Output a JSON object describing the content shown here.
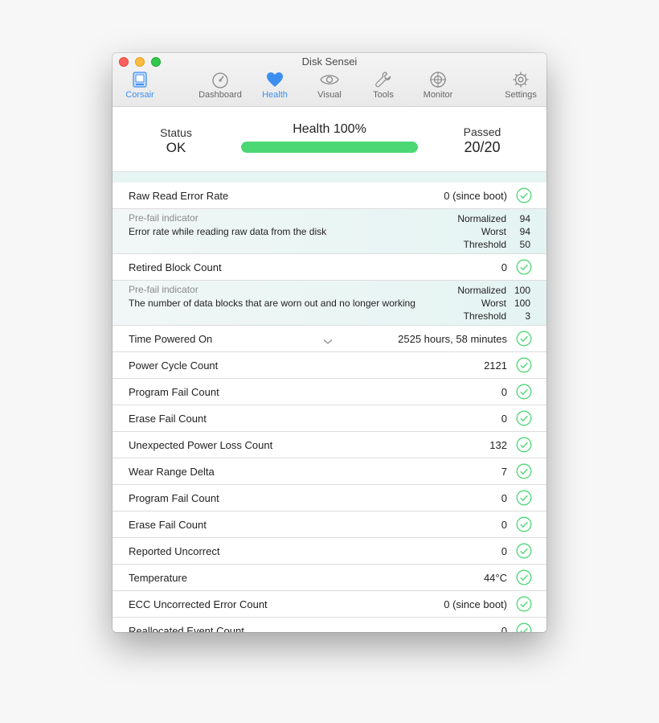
{
  "window": {
    "title": "Disk Sensei"
  },
  "toolbar": {
    "items": [
      {
        "label": "Corsair",
        "icon": "disk-icon",
        "active": true
      },
      {
        "label": "Dashboard",
        "icon": "gauge-icon"
      },
      {
        "label": "Health",
        "icon": "heart-icon",
        "active": true
      },
      {
        "label": "Visual",
        "icon": "eye-icon"
      },
      {
        "label": "Tools",
        "icon": "wrench-icon"
      },
      {
        "label": "Monitor",
        "icon": "crosshair-icon"
      },
      {
        "label": "Settings",
        "icon": "gear-icon"
      }
    ]
  },
  "summary": {
    "status_label": "Status",
    "status_value": "OK",
    "health_label": "Health 100%",
    "health_percent": 100,
    "passed_label": "Passed",
    "passed_value": "20/20"
  },
  "colors": {
    "accent": "#3c8ff0",
    "health_bar": "#4cd775",
    "check": "#4cd775",
    "detail_bg": "#e4f4f2"
  },
  "attributes": [
    {
      "name": "Raw Read Error Rate",
      "value": "0 (since boot)",
      "status": "ok",
      "detail": {
        "kind": "Pre-fail indicator",
        "description": "Error rate while reading raw data from the disk",
        "metrics": [
          {
            "label": "Normalized",
            "value": "94"
          },
          {
            "label": "Worst",
            "value": "94"
          },
          {
            "label": "Threshold",
            "value": "50"
          }
        ]
      }
    },
    {
      "name": "Retired Block Count",
      "value": "0",
      "status": "ok",
      "detail": {
        "kind": "Pre-fail indicator",
        "description": "The number of data blocks that are worn out and no longer working",
        "metrics": [
          {
            "label": "Normalized",
            "value": "100"
          },
          {
            "label": "Worst",
            "value": "100"
          },
          {
            "label": "Threshold",
            "value": "3"
          }
        ]
      }
    },
    {
      "name": "Time Powered On",
      "value": "2525 hours, 58 minutes",
      "status": "ok"
    },
    {
      "name": "Power Cycle Count",
      "value": "2121",
      "status": "ok"
    },
    {
      "name": "Program Fail Count",
      "value": "0",
      "status": "ok"
    },
    {
      "name": "Erase Fail Count",
      "value": "0",
      "status": "ok"
    },
    {
      "name": "Unexpected Power Loss Count",
      "value": "132",
      "status": "ok"
    },
    {
      "name": "Wear Range Delta",
      "value": "7",
      "status": "ok"
    },
    {
      "name": "Program Fail Count",
      "value": "0",
      "status": "ok"
    },
    {
      "name": "Erase Fail Count",
      "value": "0",
      "status": "ok"
    },
    {
      "name": "Reported Uncorrect",
      "value": "0",
      "status": "ok"
    },
    {
      "name": "Temperature",
      "value": "44°C",
      "status": "ok"
    },
    {
      "name": "ECC Uncorrected Error Count",
      "value": "0 (since boot)",
      "status": "ok"
    },
    {
      "name": "Reallocated Event Count",
      "value": "0",
      "status": "ok"
    }
  ]
}
